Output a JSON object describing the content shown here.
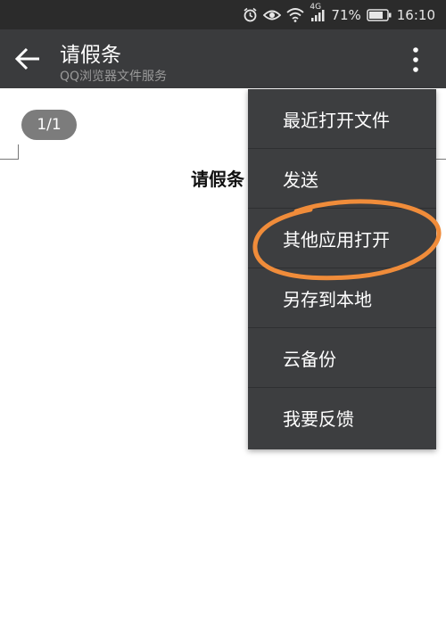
{
  "status_bar": {
    "network_label": "4G",
    "battery": "71%",
    "time": "16:10"
  },
  "app_bar": {
    "title": "请假条",
    "subtitle": "QQ浏览器文件服务"
  },
  "document": {
    "page_indicator": "1/1",
    "heading": "请假条"
  },
  "menu": {
    "items": [
      {
        "label": "最近打开文件"
      },
      {
        "label": "发送"
      },
      {
        "label": "其他应用打开"
      },
      {
        "label": "另存到本地"
      },
      {
        "label": "云备份"
      },
      {
        "label": "我要反馈"
      }
    ]
  },
  "annotation": {
    "highlight_color": "#f08c3a"
  }
}
